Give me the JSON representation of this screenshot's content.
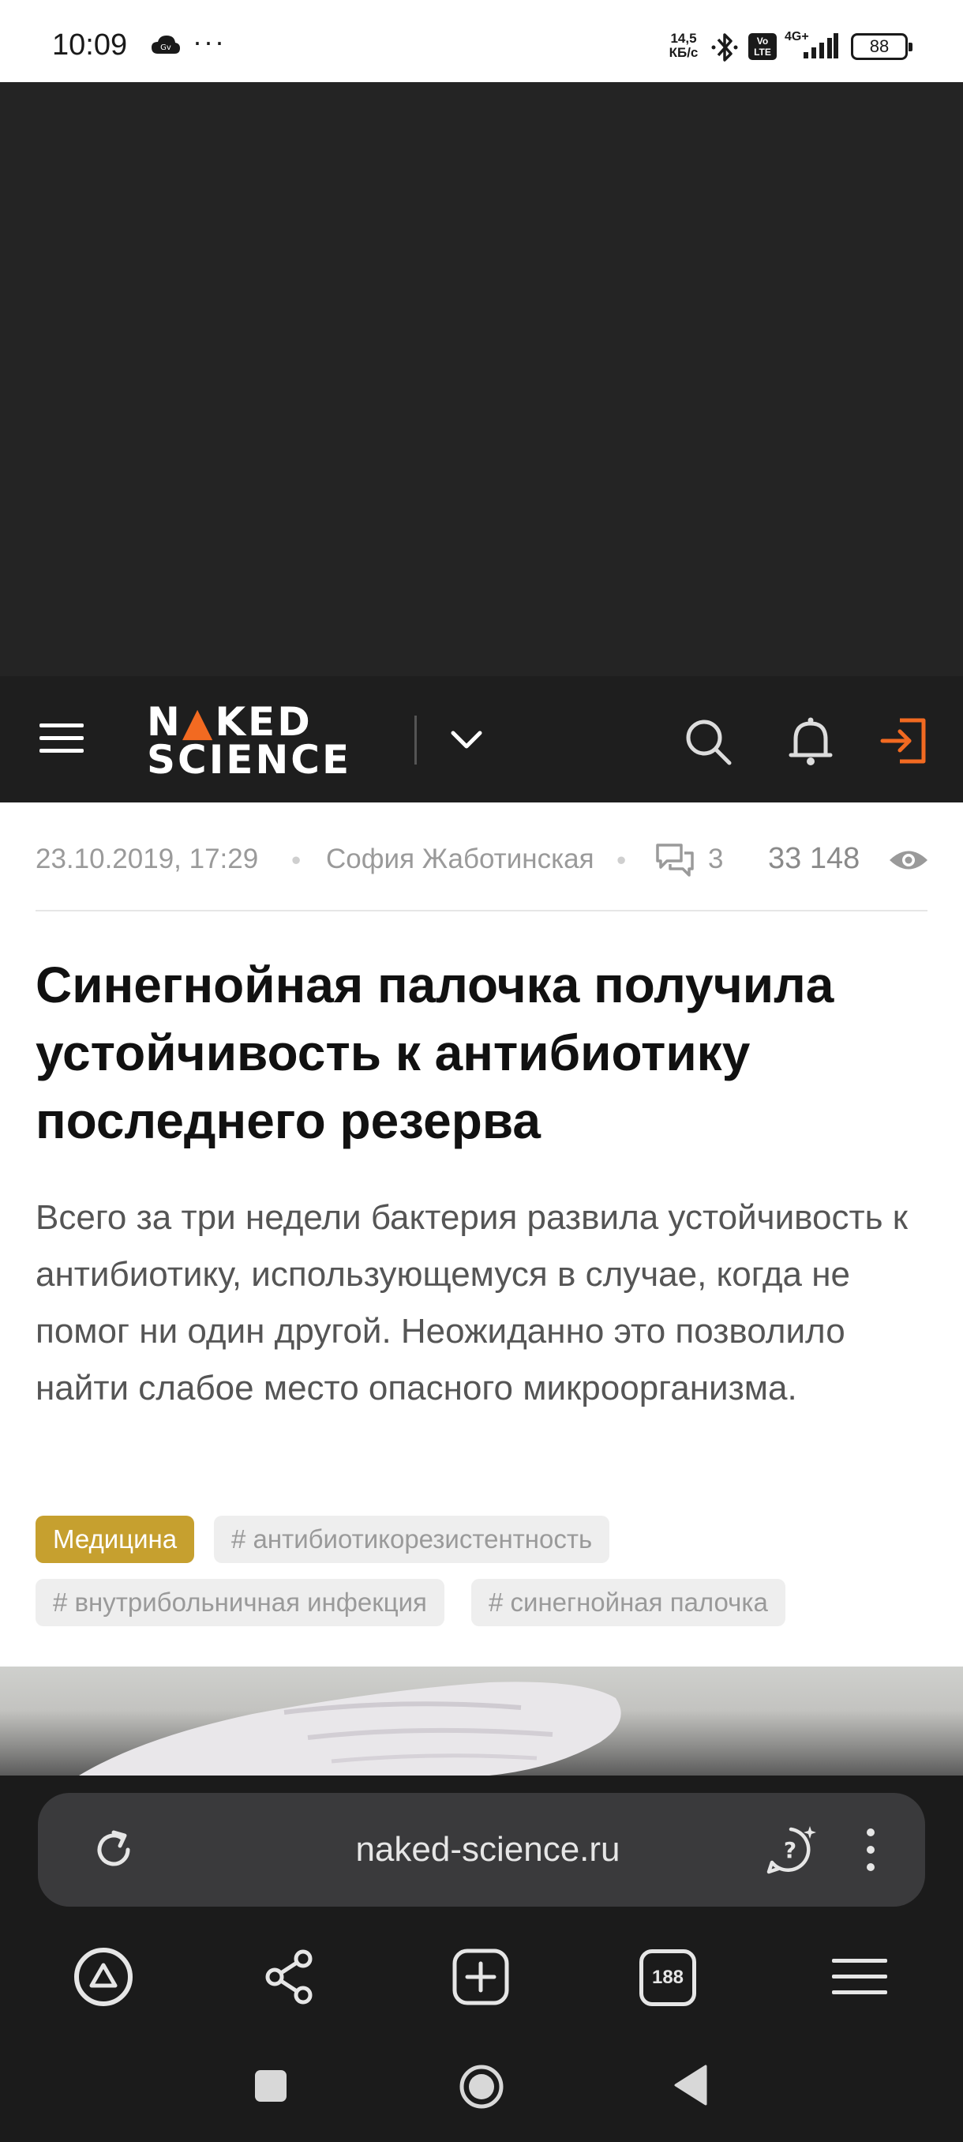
{
  "status_bar": {
    "time": "10:09",
    "cloud_label": "Gv",
    "dots": "···",
    "speed": "14,5 КБ/с",
    "volte": "Vo LTE",
    "network": "4G+",
    "battery": "88"
  },
  "header": {
    "logo_line1_a": "N",
    "logo_line1_b": "KED",
    "logo_line2": "SCIENCE",
    "accent_color": "#f26a21"
  },
  "article": {
    "date": "23.10.2019, 17:29",
    "author": "София Жаботинская",
    "comments": "3",
    "views": "33 148",
    "title": "Синегнойная палочка получила устойчивость к антибиотику последнего резерва",
    "lead": "Всего за три недели бактерия развила устойчивость к антибиотику, использующемуся в случае, когда не помог ни один другой. Неожиданно это позволило найти слабое место опасного микроорганизма.",
    "category": "Медицина",
    "category_color": "#c6a02f",
    "tags": [
      "# антибиотикорезистентность",
      "# внутрибольничная инфекция",
      "# синегнойная палочка"
    ]
  },
  "browser": {
    "url": "naked-science.ru",
    "tab_count": "188"
  },
  "icons": {
    "status": [
      "cloud-icon",
      "bluetooth-icon",
      "signal-icon",
      "battery-icon"
    ],
    "header": [
      "menu-icon",
      "chevron-down-icon",
      "search-icon",
      "bell-icon",
      "login-icon"
    ],
    "browser": [
      "reload-icon",
      "assistant-icon",
      "more-vertical-icon",
      "home-icon",
      "share-icon",
      "new-tab-icon",
      "tabs-icon",
      "menu-icon"
    ],
    "system_nav": [
      "recents-icon",
      "home-circle-icon",
      "back-icon"
    ]
  }
}
